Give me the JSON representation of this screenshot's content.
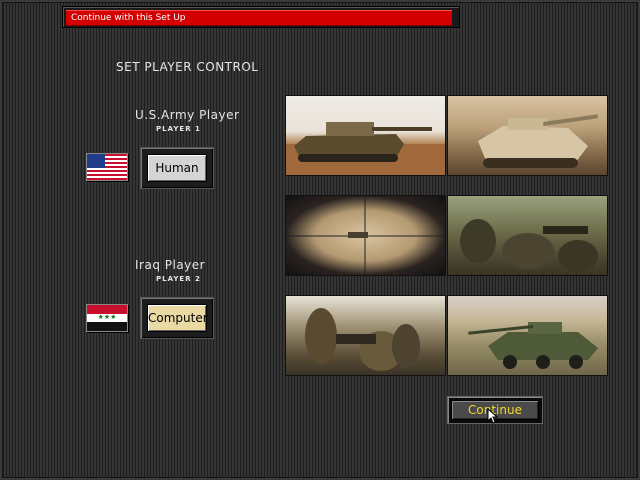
{
  "status_bar": {
    "text": "Continue with this Set Up"
  },
  "title": "SET PLAYER CONTROL",
  "player1": {
    "name": "U.S.Army Player",
    "sub": "PLAYER 1",
    "control": "Human",
    "flag": "usa-flag-icon"
  },
  "player2": {
    "name": "Iraq Player",
    "sub": "PLAYER 2",
    "control": "Computer",
    "flag": "iraq-flag-icon",
    "flag_text": "★★★"
  },
  "continue_label": "Continue",
  "colors": {
    "status_red": "#d20000",
    "continue_text": "#f0d62a",
    "computer_button": "#e9d9a2",
    "human_button": "#d4d4d4"
  }
}
